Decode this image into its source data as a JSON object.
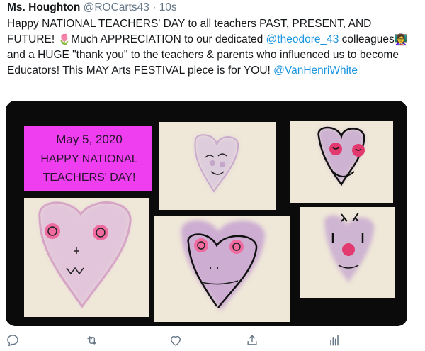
{
  "tweet": {
    "author_name": "Ms. Houghton",
    "author_handle": "@ROCarts43",
    "separator": "·",
    "time": "10s",
    "text_1": "Happy NATIONAL TEACHERS' DAY to all teachers PAST, PRESENT, AND FUTURE! ",
    "emoji_tulip": "🌷",
    "text_2": "Much APPRECIATION to our dedicated ",
    "mention_1": "@theodore_43",
    "text_3": " colleagues",
    "emoji_teacher": "👩‍🏫",
    "text_4": " and a HUGE \"thank you\" to the teachers & parents who influenced us to become Educators!  This MAY Arts FESTIVAL piece is for YOU! ",
    "mention_2": "@VanHenriWhite"
  },
  "media": {
    "sign_line_1": "May 5, 2020",
    "sign_line_2": "HAPPY NATIONAL",
    "sign_line_3": "TEACHERS' DAY!",
    "sign_color": "#ef3ef0",
    "background_color": "#0b0b0b"
  },
  "actions": {
    "icons": [
      "reply-icon",
      "retweet-icon",
      "like-icon",
      "share-icon",
      "analytics-icon"
    ]
  }
}
